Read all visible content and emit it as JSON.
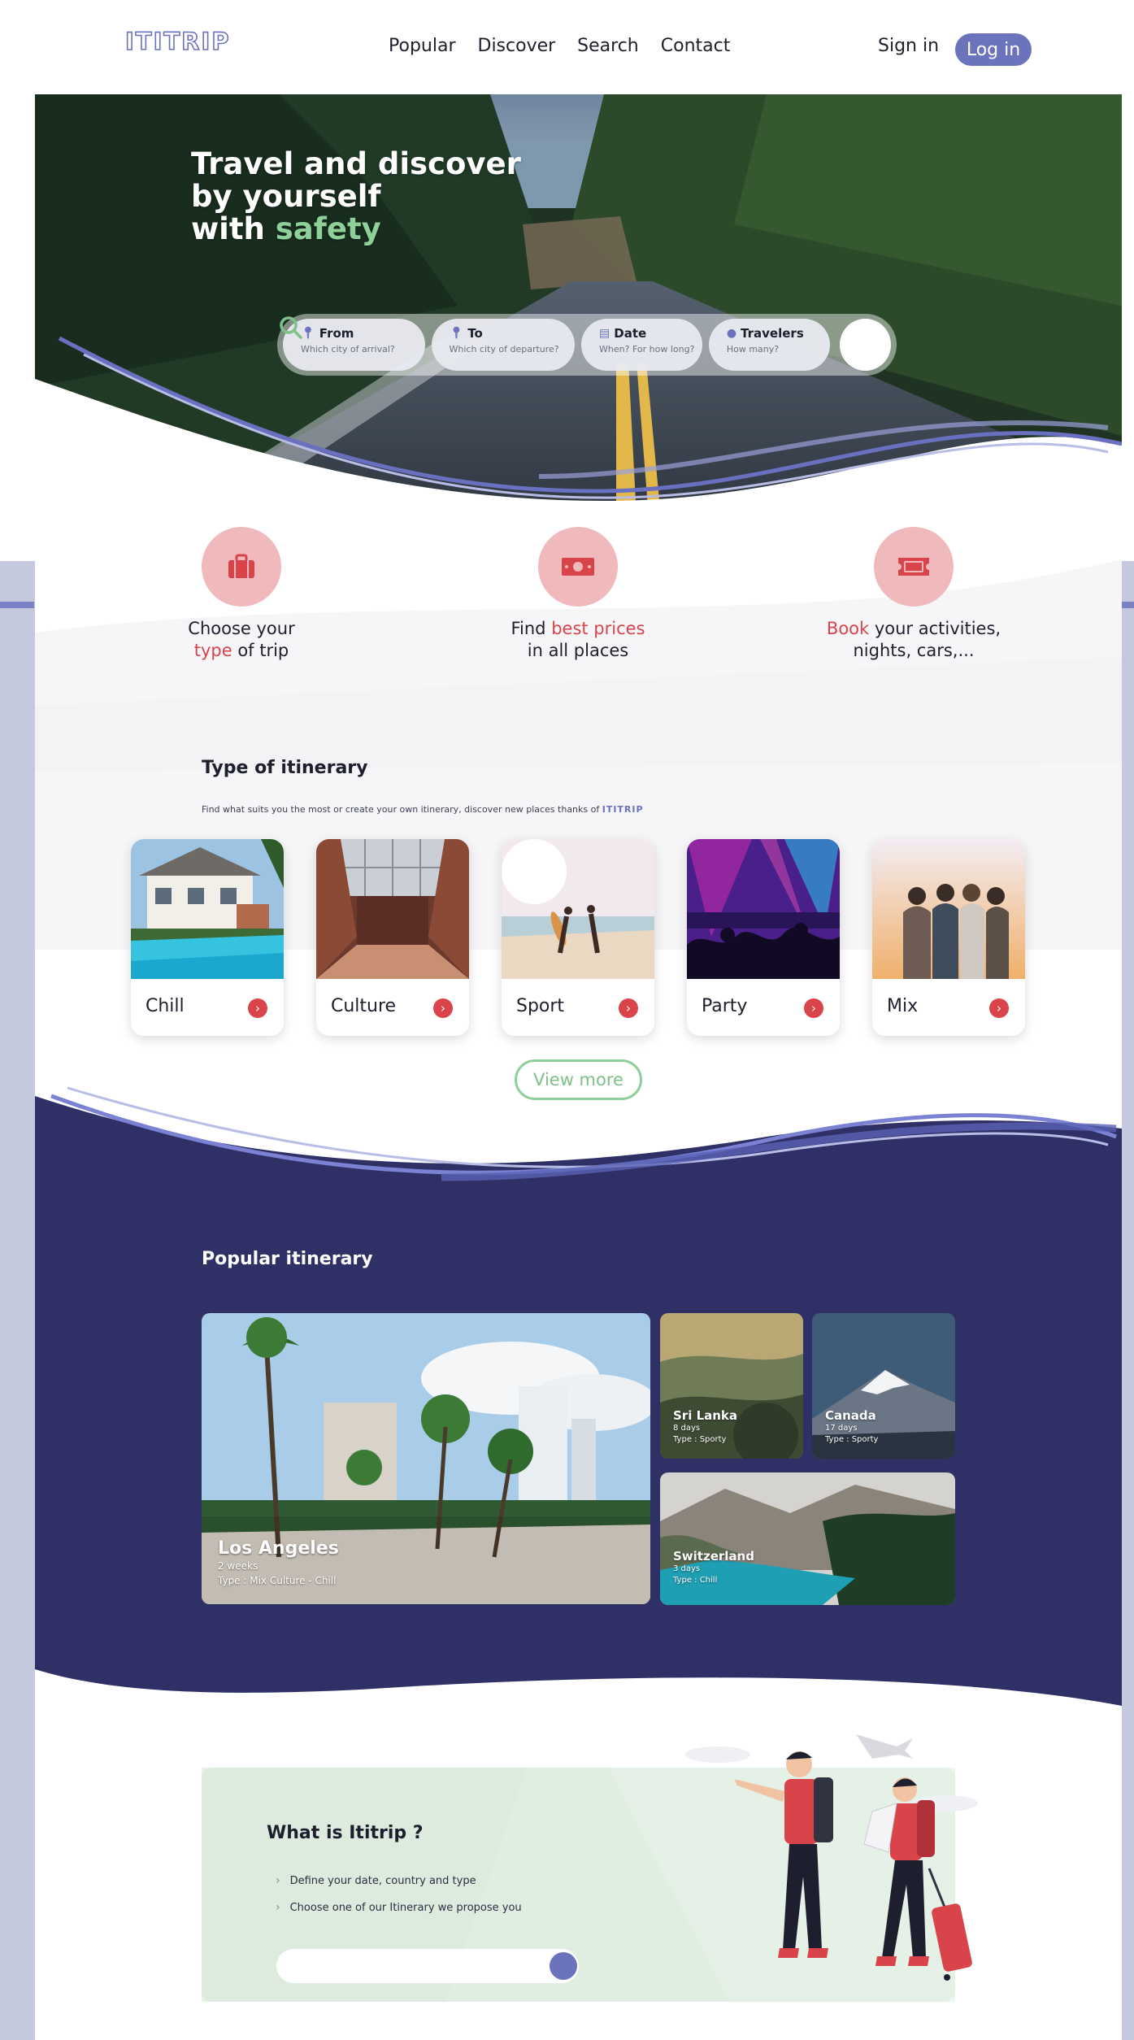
{
  "brand": {
    "logo": "ITITRIP"
  },
  "nav": {
    "links": [
      "Popular",
      "Discover",
      "Search",
      "Contact"
    ],
    "signin": "Sign in",
    "login": "Log in"
  },
  "hero": {
    "title_line1": "Travel and discover",
    "title_line2": "by yourself",
    "title_line3_prefix": "with ",
    "title_line3_accent": "safety"
  },
  "search": {
    "fields": [
      {
        "label": "From",
        "hint": "Which city of arrival?",
        "icon": "map-pin-icon"
      },
      {
        "label": "To",
        "hint": "Which city of departure?",
        "icon": "map-pin-icon"
      },
      {
        "label": "Date",
        "hint": "When? For how long?",
        "icon": "calendar-icon"
      },
      {
        "label": "Travelers",
        "hint": "How many?",
        "icon": "user-icon"
      }
    ],
    "button_icon": "search-icon"
  },
  "features": [
    {
      "icon": "suitcase-icon",
      "line1": "Choose your",
      "line2_accent": "type",
      "line2_rest": " of trip"
    },
    {
      "icon": "money-icon",
      "line1_prefix": "Find ",
      "line1_accent": "best prices",
      "line2": "in all places"
    },
    {
      "icon": "ticket-icon",
      "line1_accent": "Book",
      "line1_rest": " your activities,",
      "line2": "nights, cars,..."
    }
  ],
  "types": {
    "title": "Type of itinerary",
    "subtitle": "Find what suits you the most or create your own itinerary, discover new places thanks of ",
    "subtitle_brand": "ITITRIP",
    "cards": [
      "Chill",
      "Culture",
      "Sport",
      "Party",
      "Mix"
    ],
    "view_more": "View more"
  },
  "popular": {
    "title": "Popular itinerary",
    "tiles": [
      {
        "name": "Los Angeles",
        "duration": "2 weeks",
        "type": "Type : Mix Culture - Chill"
      },
      {
        "name": "Sri Lanka",
        "duration": "8 days",
        "type": "Type : Sporty"
      },
      {
        "name": "Canada",
        "duration": "17 days",
        "type": "Type : Sporty"
      },
      {
        "name": "Switzerland",
        "duration": "3 days",
        "type": "Type : Chill"
      }
    ]
  },
  "about": {
    "title": "What is Ititrip ?",
    "steps": [
      "Define your date, country and type",
      "Choose one of our Itinerary we propose you"
    ]
  },
  "colors": {
    "accent": "#6c73bd",
    "navy": "#2f3166",
    "red": "#d9434a",
    "green": "#8fcf9a"
  }
}
